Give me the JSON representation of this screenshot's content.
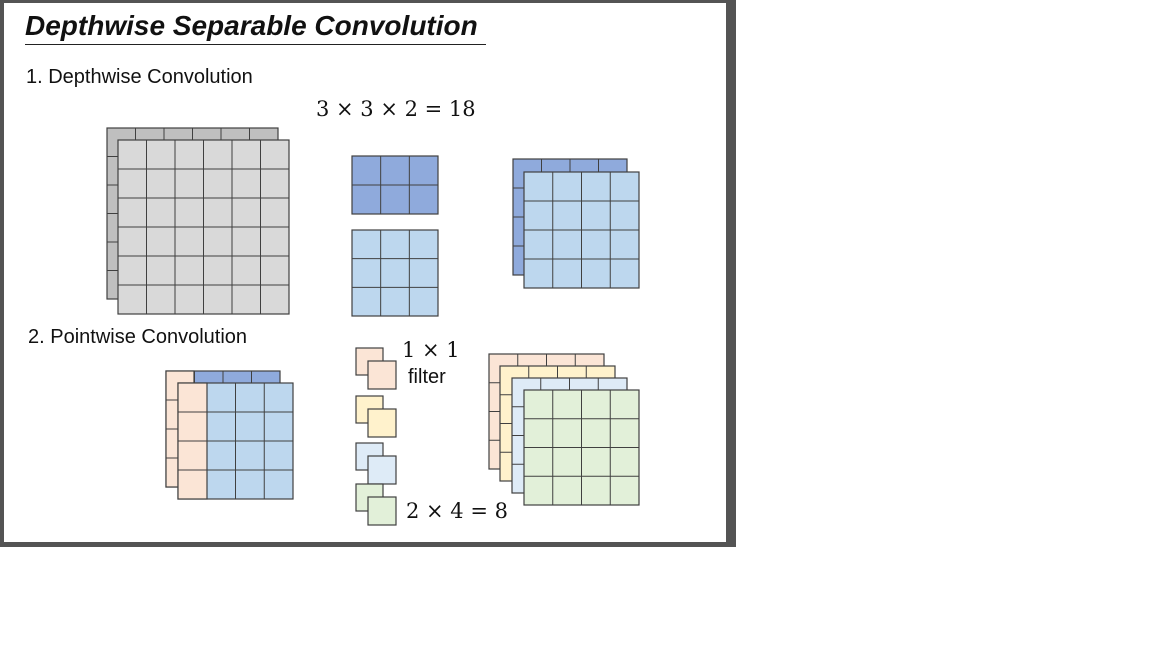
{
  "slide": {
    "title": "Depthwise Separable Convolution",
    "section1_label": "1. Depthwise Convolution",
    "section2_label": "2. Pointwise Convolution",
    "depthwise_param_formula": "3 × 3 × 2 = 18",
    "filter_size": "1 × 1",
    "filter_word": "filter",
    "pointwise_param_formula": "2 × 4 = 8"
  },
  "diagram": {
    "input_feature_map": {
      "rows": 6,
      "cols": 6,
      "channels": 2
    },
    "depthwise_kernels": {
      "rows": 3,
      "cols": 3,
      "count": 2
    },
    "depthwise_output": {
      "rows": 4,
      "cols": 4,
      "channels": 2
    },
    "pointwise_input": {
      "rows": 4,
      "cols": 4,
      "channels": 2
    },
    "pointwise_filters": {
      "count": 4,
      "channels_each": 2
    },
    "pointwise_output": {
      "rows": 4,
      "cols": 4,
      "channels": 4
    }
  },
  "colors": {
    "frame": "#545454",
    "input_gray": "#d9d9d9",
    "input_gray_back": "#bfbfbf",
    "kernel_dark_blue": "#8faadc",
    "light_blue": "#bdd7ee",
    "orange": "#fbe5d6",
    "yellow": "#fff2cc",
    "pale_blue": "#deebf7",
    "green": "#e2f0d9"
  }
}
